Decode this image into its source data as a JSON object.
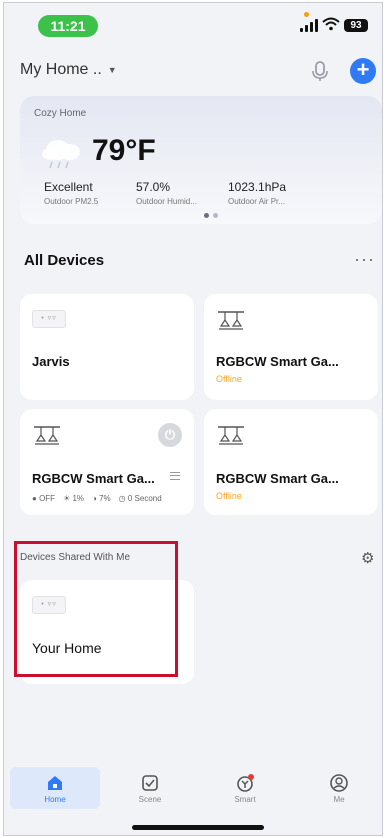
{
  "status_bar": {
    "time": "11:21",
    "battery": "93"
  },
  "header": {
    "home_name": "My Home ..",
    "add_label": "+"
  },
  "weather": {
    "location": "Cozy Home",
    "temperature": "79°F",
    "metrics": [
      {
        "value": "Excellent",
        "label": "Outdoor PM2.5"
      },
      {
        "value": "57.0%",
        "label": "Outdoor Humid..."
      },
      {
        "value": "1023.1hPa",
        "label": "Outdoor Air Pr..."
      }
    ]
  },
  "all_devices": {
    "title": "All Devices",
    "more_label": "···",
    "devices": [
      {
        "name": "Jarvis",
        "icon": "gateway-icon",
        "status": ""
      },
      {
        "name": "RGBCW Smart Ga...",
        "icon": "light-fixture-icon",
        "status": "Offline"
      },
      {
        "name": "RGBCW Smart Ga...",
        "icon": "light-fixture-icon",
        "status": "",
        "stats": [
          "OFF",
          "1%",
          "7%",
          "0 Second"
        ]
      },
      {
        "name": "RGBCW Smart Ga...",
        "icon": "light-fixture-icon",
        "status": "Offline"
      }
    ]
  },
  "shared": {
    "title": "Devices Shared With Me",
    "devices": [
      {
        "name": "Your Home",
        "icon": "gateway-icon"
      }
    ]
  },
  "tabs": [
    {
      "label": "Home",
      "icon": "home-icon",
      "active": true
    },
    {
      "label": "Scene",
      "icon": "scene-checkbox-icon",
      "active": false
    },
    {
      "label": "Smart",
      "icon": "smart-icon",
      "active": false
    },
    {
      "label": "Me",
      "icon": "profile-icon",
      "active": false
    }
  ],
  "colors": {
    "accent": "#2f7bf5",
    "offline": "#f5a623",
    "highlight": "#c8102e",
    "time_pill": "#3cc24a"
  }
}
